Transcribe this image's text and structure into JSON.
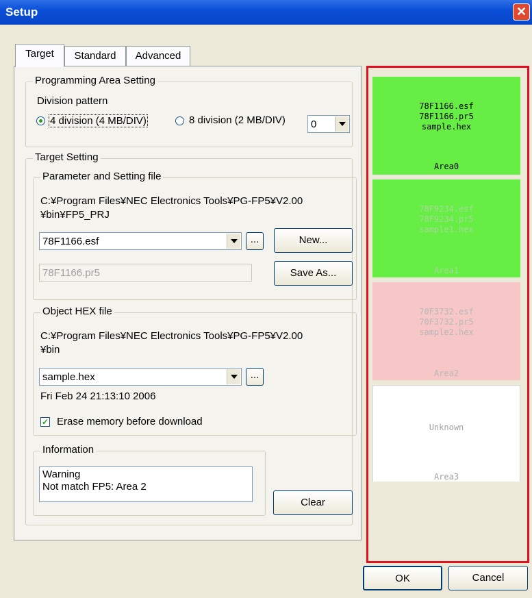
{
  "window": {
    "title": "Setup",
    "close_glyph": "✕"
  },
  "tabs": [
    {
      "label": "Target",
      "active": true
    },
    {
      "label": "Standard",
      "active": false
    },
    {
      "label": "Advanced",
      "active": false
    }
  ],
  "programming_area": {
    "legend": "Programming Area Setting",
    "division_label": "Division pattern",
    "option_4": "4 division (4 MB/DIV)",
    "option_8": "8 division (2 MB/DIV)",
    "selected": "4",
    "area_select_value": "0"
  },
  "target_setting": {
    "legend": "Target Setting",
    "param_file": {
      "legend": "Parameter and Setting file",
      "path_line1": "C:¥Program Files¥NEC Electronics Tools¥PG-FP5¥V2.00",
      "path_line2": "¥bin¥FP5_PRJ",
      "esf_value": "78F1166.esf",
      "browse_label": "...",
      "new_label": "New...",
      "pr5_value": "78F1166.pr5",
      "save_as_label": "Save As..."
    },
    "hex_file": {
      "legend": "Object HEX file",
      "path_line1": "C:¥Program Files¥NEC Electronics Tools¥PG-FP5¥V2.00",
      "path_line2": "¥bin",
      "hex_value": "sample.hex",
      "browse_label": "...",
      "timestamp": "Fri Feb 24 21:13:10 2006",
      "erase_label": "Erase memory before download",
      "erase_checked": true
    },
    "information": {
      "legend": "Information",
      "line1": "Warning",
      "line2": "Not match FP5: Area 2",
      "clear_label": "Clear"
    }
  },
  "areas": [
    {
      "name": "Area0",
      "line1": "78F1166.esf",
      "line2": "78F1166.pr5",
      "line3": "sample.hex",
      "bg": "#66ee44",
      "text_color": "#000000"
    },
    {
      "name": "Area1",
      "line1": "78F9234.esf",
      "line2": "78F9234.pr5",
      "line3": "sample1.hex",
      "bg": "#66ee44",
      "text_color": "#a6d99a"
    },
    {
      "name": "Area2",
      "line1": "70F3732.esf",
      "line2": "70F3732.pr5",
      "line3": "sample2.hex",
      "bg": "#f7c6c6",
      "text_color": "#b8b8b8"
    },
    {
      "name": "Area3",
      "line1": "Unknown",
      "bg": "#ffffff",
      "text_color": "#a0a0a0"
    }
  ],
  "footer": {
    "ok_label": "OK",
    "cancel_label": "Cancel"
  },
  "colors": {
    "highlight_frame": "#e01020",
    "titlebar": "#0a4fd8"
  }
}
